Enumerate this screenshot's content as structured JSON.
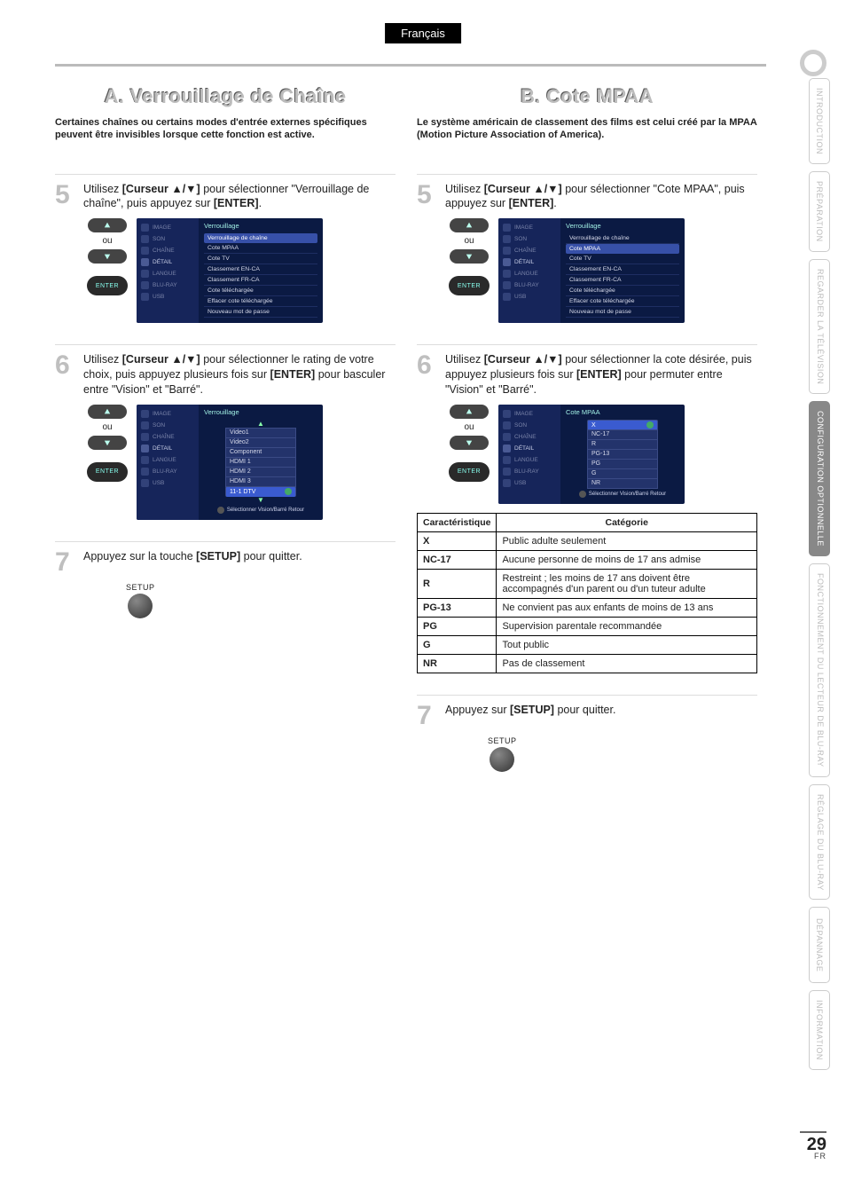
{
  "lang_tab": "Français",
  "page_number": "29",
  "page_lang_code": "FR",
  "side_tabs": [
    {
      "label": "INTRODUCTION",
      "active": false
    },
    {
      "label": "PRÉPARATION",
      "active": false
    },
    {
      "label": "REGARDER LA\nTÉLÉVISION",
      "active": false
    },
    {
      "label": "CONFIGURATION\nOPTIONNELLE",
      "active": true
    },
    {
      "label": "FONCTIONNEMENT DU\nLECTEUR DE BLU-RAY",
      "active": false
    },
    {
      "label": "RÉGLAGE DU\nBLU-RAY",
      "active": false
    },
    {
      "label": "DÉPANNAGE",
      "active": false
    },
    {
      "label": "INFORMATION",
      "active": false
    }
  ],
  "osd_side_items": [
    "IMAGE",
    "SON",
    "CHAÎNE",
    "DÉTAIL",
    "LANGUE",
    "BLU-RAY",
    "USB"
  ],
  "colA": {
    "heading": "A. Verrouillage de Chaîne",
    "intro": "Certaines chaînes ou certains modes d'entrée externes spécifiques peuvent être invisibles lorsque cette fonction est active.",
    "step5": {
      "text_pre": "Utilisez ",
      "text_bold": "[Curseur ▲/▼]",
      "text_mid": " pour sélectionner \"Verrouillage de chaîne\", puis appuyez sur ",
      "text_bold2": "[ENTER]",
      "text_end": ".",
      "ou": "ou",
      "enter": "ENTER",
      "osd_title": "Verrouillage",
      "osd_items": [
        "Verrouillage de chaîne",
        "Cote MPAA",
        "Cote TV",
        "Classement EN-CA",
        "Classement FR-CA",
        "Cote téléchargée",
        "Effacer cote téléchargée",
        "Nouveau mot de passe"
      ],
      "osd_hl_index": 0
    },
    "step6": {
      "text_pre": "Utilisez ",
      "text_bold": "[Curseur ▲/▼]",
      "text_mid": " pour sélectionner le rating de votre choix, puis appuyez plusieurs fois sur ",
      "text_bold2": "[ENTER]",
      "text_end": " pour basculer entre \"Vision\" et \"Barré\".",
      "ou": "ou",
      "enter": "ENTER",
      "osd_title": "Verrouillage",
      "osd_items": [
        "Video1",
        "Video2",
        "Component",
        "HDMI 1",
        "HDMI 2",
        "HDMI 3",
        "11-1 DTV"
      ],
      "osd_footer": "Sélectionner        Vision/Barré        Retour"
    },
    "step7": {
      "text_pre": "Appuyez sur la touche ",
      "text_bold": "[SETUP]",
      "text_end": " pour quitter.",
      "setup": "SETUP"
    }
  },
  "colB": {
    "heading": "B. Cote MPAA",
    "intro": "Le système américain de classement des films est celui créé par la MPAA (Motion Picture Association of America).",
    "step5": {
      "text_pre": "Utilisez ",
      "text_bold": "[Curseur ▲/▼]",
      "text_mid": " pour sélectionner \"Cote MPAA\", puis appuyez sur ",
      "text_bold2": "[ENTER]",
      "text_end": ".",
      "ou": "ou",
      "enter": "ENTER",
      "osd_title": "Verrouillage",
      "osd_items": [
        "Verrouillage de chaîne",
        "Cote MPAA",
        "Cote TV",
        "Classement EN-CA",
        "Classement FR-CA",
        "Cote téléchargée",
        "Effacer cote téléchargée",
        "Nouveau mot de passe"
      ],
      "osd_hl_index": 1
    },
    "step6": {
      "text_pre": "Utilisez ",
      "text_bold": "[Curseur ▲/▼]",
      "text_mid": " pour sélectionner la cote désirée, puis appuyez plusieurs fois sur ",
      "text_bold2": "[ENTER]",
      "text_end": " pour permuter entre \"Vision\" et \"Barré\".",
      "ou": "ou",
      "enter": "ENTER",
      "osd_title": "Cote MPAA",
      "osd_items": [
        "X",
        "NC-17",
        "R",
        "PG-13",
        "PG",
        "G",
        "NR"
      ],
      "osd_footer": "Sélectionner        Vision/Barré        Retour"
    },
    "rating_table": {
      "head1": "Caractéristique",
      "head2": "Catégorie",
      "rows": [
        {
          "k": "X",
          "v": "Public adulte seulement"
        },
        {
          "k": "NC-17",
          "v": "Aucune personne de moins de 17 ans admise"
        },
        {
          "k": "R",
          "v": "Restreint ; les moins de 17 ans doivent être accompagnés d'un parent ou d'un tuteur adulte"
        },
        {
          "k": "PG-13",
          "v": "Ne convient pas aux enfants de moins de 13 ans"
        },
        {
          "k": "PG",
          "v": "Supervision parentale recommandée"
        },
        {
          "k": "G",
          "v": "Tout public"
        },
        {
          "k": "NR",
          "v": "Pas de classement"
        }
      ]
    },
    "step7": {
      "text_pre": "Appuyez sur ",
      "text_bold": "[SETUP]",
      "text_end": " pour quitter.",
      "setup": "SETUP"
    }
  }
}
